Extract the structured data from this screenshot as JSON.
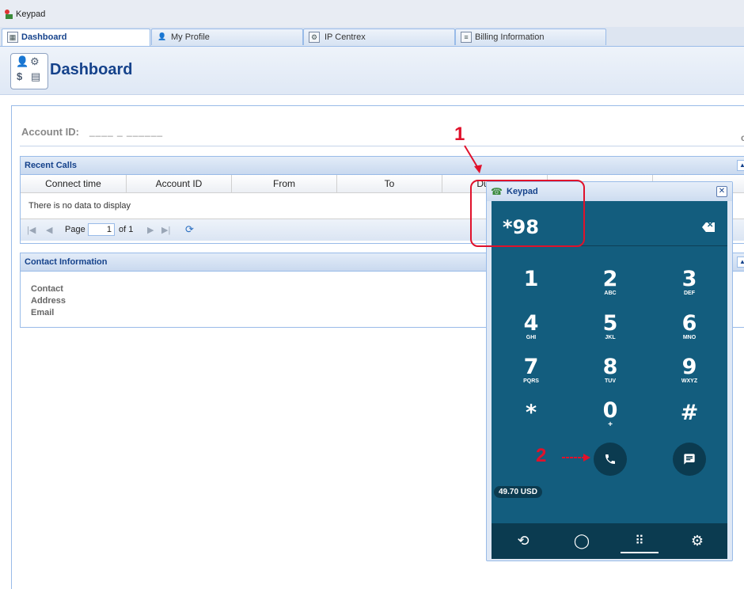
{
  "app": {
    "title": "Keypad"
  },
  "tabs": [
    {
      "label": "Dashboard",
      "icon": "dashboard-icon",
      "active": true
    },
    {
      "label": "My Profile",
      "icon": "user-icon",
      "active": false
    },
    {
      "label": "IP Centrex",
      "icon": "gear-icon",
      "active": false
    },
    {
      "label": "Billing Information",
      "icon": "document-icon",
      "active": false
    }
  ],
  "header": {
    "title": "Dashboard"
  },
  "account": {
    "label": "Account ID:",
    "value": "____ _ ______"
  },
  "right_glyph": "c",
  "recent_calls": {
    "title": "Recent Calls",
    "columns": [
      "Connect time",
      "Account ID",
      "From",
      "To",
      "Duration"
    ],
    "empty_text": "There is no data to display",
    "pager": {
      "page_label": "Page",
      "page_value": "1",
      "of_label": "of 1"
    }
  },
  "contact": {
    "title": "Contact Information",
    "fields": [
      "Contact",
      "Address",
      "Email"
    ]
  },
  "keypad": {
    "title": "Keypad",
    "display": "*98",
    "keys": [
      {
        "digit": "1",
        "letters": ""
      },
      {
        "digit": "2",
        "letters": "ABC"
      },
      {
        "digit": "3",
        "letters": "DEF"
      },
      {
        "digit": "4",
        "letters": "GHI"
      },
      {
        "digit": "5",
        "letters": "JKL"
      },
      {
        "digit": "6",
        "letters": "MNO"
      },
      {
        "digit": "7",
        "letters": "PQRS"
      },
      {
        "digit": "8",
        "letters": "TUV"
      },
      {
        "digit": "9",
        "letters": "WXYZ"
      },
      {
        "digit": "*",
        "letters": ""
      },
      {
        "digit": "0",
        "letters": "+"
      },
      {
        "digit": "#",
        "letters": ""
      }
    ],
    "balance": "49.70 USD",
    "footer_tabs": [
      "history-icon",
      "chat-icon",
      "keypad-grid-icon",
      "settings-icon"
    ],
    "active_footer": "keypad-grid-icon"
  },
  "annotations": {
    "marker_1": "1",
    "marker_2": "2",
    "color": "#e0112b"
  }
}
